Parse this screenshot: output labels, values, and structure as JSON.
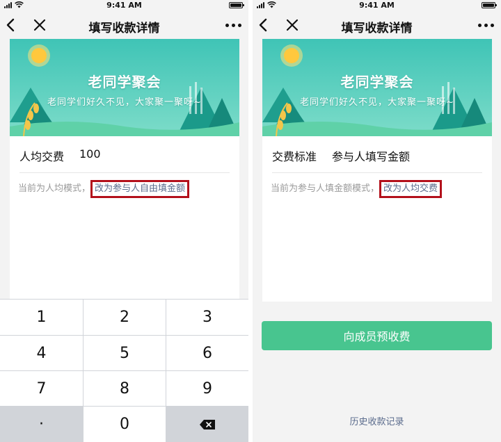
{
  "colors": {
    "accent_green": "#48c58f",
    "highlight_red": "#b3101b",
    "link_blue": "#5a6b8c",
    "hint_gray": "#9a9a9a",
    "banner_teal": "#3fc4b6"
  },
  "screens": {
    "left": {
      "status": {
        "time": "9:41 AM"
      },
      "nav": {
        "title": "填写收款详情",
        "back_icon": "chevron-left-icon",
        "close_icon": "close-icon",
        "more_icon": "more-dots-icon"
      },
      "banner": {
        "title": "老同学聚会",
        "subtitle": "老同学们好久不见，大家聚一聚呀~"
      },
      "field": {
        "label": "人均交费",
        "value": "100"
      },
      "hint": {
        "text": "当前为人均模式，",
        "link": "改为参与人自由填金额"
      },
      "keypad": {
        "keys": [
          "1",
          "2",
          "3",
          "4",
          "5",
          "6",
          "7",
          "8",
          "9",
          "·",
          "0"
        ],
        "delete_icon": "backspace-icon"
      }
    },
    "right": {
      "status": {
        "time": "9:41 AM"
      },
      "nav": {
        "title": "填写收款详情",
        "back_icon": "chevron-left-icon",
        "close_icon": "close-icon",
        "more_icon": "more-dots-icon"
      },
      "banner": {
        "title": "老同学聚会",
        "subtitle": "老同学们好久不见，大家聚一聚呀~"
      },
      "field": {
        "label": "交费标准",
        "value": "参与人填写金额"
      },
      "hint": {
        "text": "当前为参与人填金额模式，",
        "link": "改为人均交费"
      },
      "primary_button": "向成员预收费",
      "history_link": "历史收款记录"
    }
  }
}
